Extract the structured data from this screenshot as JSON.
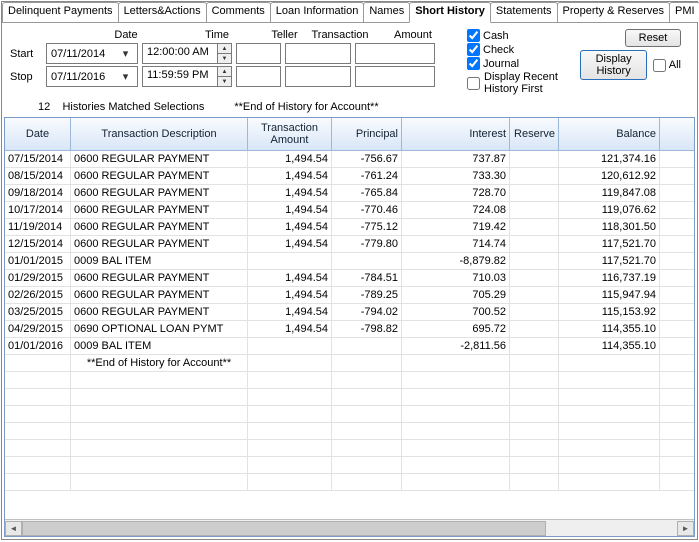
{
  "tabs": [
    "Delinquent Payments",
    "Letters&Actions",
    "Comments",
    "Loan Information",
    "Names",
    "Short History",
    "Statements",
    "Property & Reserves",
    "PMI"
  ],
  "activeTab": 5,
  "filter": {
    "headers": {
      "date": "Date",
      "time": "Time",
      "teller": "Teller",
      "transaction": "Transaction",
      "amount": "Amount"
    },
    "startLabel": "Start",
    "stopLabel": "Stop",
    "startDate": "07/11/2014",
    "startTime": "12:00:00 AM",
    "stopDate": "07/11/2016",
    "stopTime": "11:59:59 PM",
    "teller": "",
    "transaction": "",
    "amount": "",
    "cash": {
      "label": "Cash",
      "checked": true
    },
    "check": {
      "label": "Check",
      "checked": true
    },
    "journal": {
      "label": "Journal",
      "checked": true
    },
    "recent": {
      "label": "Display Recent History First",
      "checked": false
    },
    "all": {
      "label": "All",
      "checked": false
    },
    "resetBtn": "Reset",
    "displayBtn": "Display History"
  },
  "status": {
    "count": "12",
    "matched": "Histories Matched Selections",
    "endmsg": "**End of History for Account**"
  },
  "columns": {
    "date": "Date",
    "desc": "Transaction Description",
    "txamt": "Transaction Amount",
    "principal": "Principal",
    "interest": "Interest",
    "reserve": "Reserve",
    "balance": "Balance"
  },
  "rows": [
    {
      "date": "07/15/2014",
      "desc": "0600 REGULAR PAYMENT",
      "txamt": "1,494.54",
      "principal": "-756.67",
      "interest": "737.87",
      "reserve": "",
      "balance": "121,374.16"
    },
    {
      "date": "08/15/2014",
      "desc": "0600 REGULAR PAYMENT",
      "txamt": "1,494.54",
      "principal": "-761.24",
      "interest": "733.30",
      "reserve": "",
      "balance": "120,612.92"
    },
    {
      "date": "09/18/2014",
      "desc": "0600 REGULAR PAYMENT",
      "txamt": "1,494.54",
      "principal": "-765.84",
      "interest": "728.70",
      "reserve": "",
      "balance": "119,847.08"
    },
    {
      "date": "10/17/2014",
      "desc": "0600 REGULAR PAYMENT",
      "txamt": "1,494.54",
      "principal": "-770.46",
      "interest": "724.08",
      "reserve": "",
      "balance": "119,076.62"
    },
    {
      "date": "11/19/2014",
      "desc": "0600 REGULAR PAYMENT",
      "txamt": "1,494.54",
      "principal": "-775.12",
      "interest": "719.42",
      "reserve": "",
      "balance": "118,301.50"
    },
    {
      "date": "12/15/2014",
      "desc": "0600 REGULAR PAYMENT",
      "txamt": "1,494.54",
      "principal": "-779.80",
      "interest": "714.74",
      "reserve": "",
      "balance": "117,521.70"
    },
    {
      "date": "01/01/2015",
      "desc": "0009 BAL ITEM",
      "txamt": "",
      "principal": "",
      "interest": "-8,879.82",
      "reserve": "",
      "balance": "117,521.70"
    },
    {
      "date": "01/29/2015",
      "desc": "0600 REGULAR PAYMENT",
      "txamt": "1,494.54",
      "principal": "-784.51",
      "interest": "710.03",
      "reserve": "",
      "balance": "116,737.19"
    },
    {
      "date": "02/26/2015",
      "desc": "0600 REGULAR PAYMENT",
      "txamt": "1,494.54",
      "principal": "-789.25",
      "interest": "705.29",
      "reserve": "",
      "balance": "115,947.94"
    },
    {
      "date": "03/25/2015",
      "desc": "0600 REGULAR PAYMENT",
      "txamt": "1,494.54",
      "principal": "-794.02",
      "interest": "700.52",
      "reserve": "",
      "balance": "115,153.92"
    },
    {
      "date": "04/29/2015",
      "desc": "0690 OPTIONAL LOAN PYMT",
      "txamt": "1,494.54",
      "principal": "-798.82",
      "interest": "695.72",
      "reserve": "",
      "balance": "114,355.10"
    },
    {
      "date": "01/01/2016",
      "desc": "0009 BAL ITEM",
      "txamt": "",
      "principal": "",
      "interest": "-2,811.56",
      "reserve": "",
      "balance": "114,355.10"
    }
  ],
  "endOfHistoryRow": "**End of History for Account**"
}
